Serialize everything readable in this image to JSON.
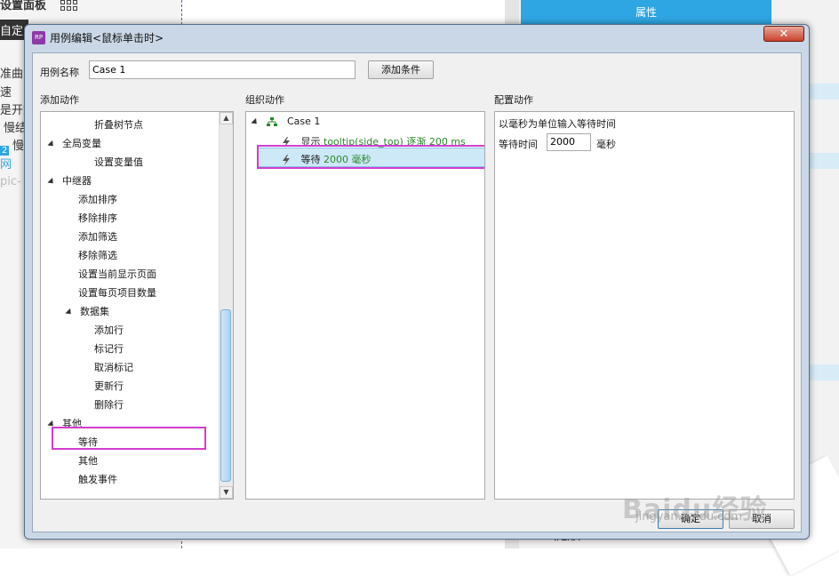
{
  "background": {
    "left_fragments": [
      "设置面板",
      "自定",
      "准曲",
      "速",
      "是开始",
      "慢结",
      "慢",
      "2",
      "网",
      "pic-"
    ],
    "properties_tab": "属性",
    "rectangle_label": "A（矩形）"
  },
  "dialog": {
    "title": "用例编辑<鼠标单击时>",
    "app_icon_text": "RP",
    "close_label": "✕",
    "case_name_label": "用例名称",
    "case_name_value": "Case 1",
    "add_condition_label": "添加条件",
    "sections": {
      "add_action": "添加动作",
      "organize_action": "组织动作",
      "configure_action": "配置动作"
    },
    "actions_tree": [
      {
        "label": "折叠树节点",
        "level": 2,
        "expander": false
      },
      {
        "label": "全局变量",
        "level": 0,
        "expander": true
      },
      {
        "label": "设置变量值",
        "level": 2,
        "expander": false
      },
      {
        "label": "中继器",
        "level": 0,
        "expander": true
      },
      {
        "label": "添加排序",
        "level": 1,
        "expander": false
      },
      {
        "label": "移除排序",
        "level": 1,
        "expander": false
      },
      {
        "label": "添加筛选",
        "level": 1,
        "expander": false
      },
      {
        "label": "移除筛选",
        "level": 1,
        "expander": false
      },
      {
        "label": "设置当前显示页面",
        "level": 1,
        "expander": false
      },
      {
        "label": "设置每页项目数量",
        "level": 1,
        "expander": false
      },
      {
        "label": "数据集",
        "level": 1,
        "expander": true
      },
      {
        "label": "添加行",
        "level": 2,
        "expander": false
      },
      {
        "label": "标记行",
        "level": 2,
        "expander": false
      },
      {
        "label": "取消标记",
        "level": 2,
        "expander": false
      },
      {
        "label": "更新行",
        "level": 2,
        "expander": false
      },
      {
        "label": "删除行",
        "level": 2,
        "expander": false
      },
      {
        "label": "其他",
        "level": 0,
        "expander": true
      },
      {
        "label": "等待",
        "level": 1,
        "expander": false,
        "highlighted": true
      },
      {
        "label": "其他",
        "level": 1,
        "expander": false
      },
      {
        "label": "触发事件",
        "level": 1,
        "expander": false
      }
    ],
    "organize": {
      "case_label": "Case 1",
      "actions": [
        {
          "verb": "显示",
          "detail": "tooltip(side_top) 逐渐 200 ms",
          "selected": false
        },
        {
          "verb": "等待",
          "detail": "2000 毫秒",
          "selected": true
        }
      ]
    },
    "configure": {
      "instruction": "以毫秒为单位输入等待时间",
      "wait_label": "等待时间",
      "wait_value": "2000",
      "unit": "毫秒"
    },
    "ok_label": "确定",
    "cancel_label": "取消"
  },
  "watermark": {
    "main": "Baidu经验",
    "sub": "jingyan.baidu.com"
  },
  "colors": {
    "highlight": "#d23dd0",
    "selection": "#cde8f7",
    "green_text": "#2a8a2a",
    "accent": "#2ea6e3"
  }
}
